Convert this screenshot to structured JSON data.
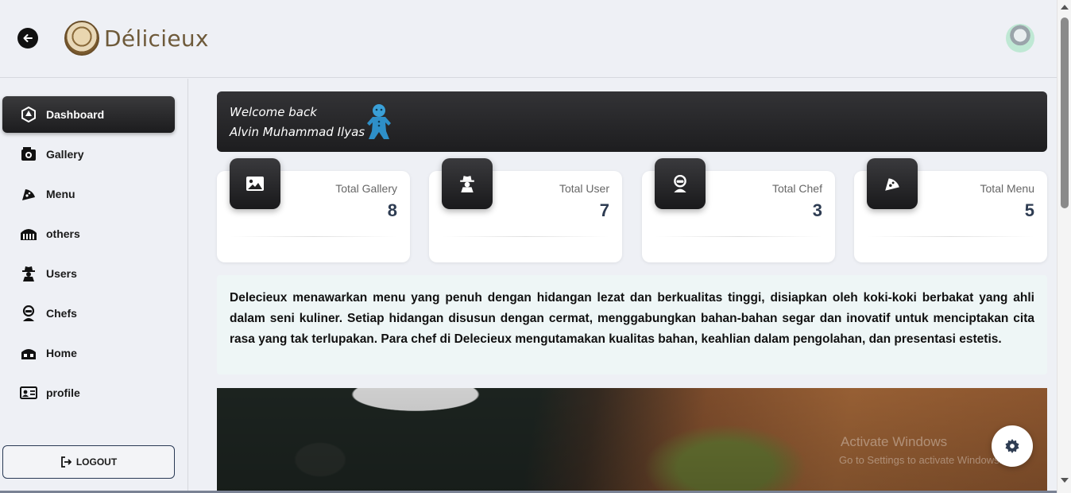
{
  "header": {
    "brand_name": "Délicieux",
    "back_icon": "arrow-left-circle-icon",
    "logo_icon": "burger-logo-icon",
    "avatar_icon": "user-avatar-icon"
  },
  "sidebar": {
    "items": [
      {
        "label": "Dashboard",
        "icon": "dashboard-icon",
        "active": true
      },
      {
        "label": "Gallery",
        "icon": "gallery-icon",
        "active": false
      },
      {
        "label": "Menu",
        "icon": "pizza-icon",
        "active": false
      },
      {
        "label": "others",
        "icon": "store-icon",
        "active": false
      },
      {
        "label": "Users",
        "icon": "user-secret-icon",
        "active": false
      },
      {
        "label": "Chefs",
        "icon": "chef-icon",
        "active": false
      },
      {
        "label": "Home",
        "icon": "home-icon",
        "active": false
      },
      {
        "label": "profile",
        "icon": "id-card-icon",
        "active": false
      }
    ],
    "logout_label": "LOGOUT"
  },
  "welcome": {
    "line1": "Welcome back",
    "line2": "Alvin Muhammad Ilyas"
  },
  "stats": [
    {
      "label": "Total Gallery",
      "value": "8",
      "icon": "image-icon"
    },
    {
      "label": "Total User",
      "value": "7",
      "icon": "user-secret-icon"
    },
    {
      "label": "Total Chef",
      "value": "3",
      "icon": "chef-icon"
    },
    {
      "label": "Total Menu",
      "value": "5",
      "icon": "pizza-icon"
    }
  ],
  "about": {
    "text": "Delecieux menawarkan menu yang penuh dengan hidangan lezat dan berkualitas tinggi, disiapkan oleh koki-koki berbakat yang ahli dalam seni kuliner. Setiap hidangan disusun dengan cermat, menggabungkan bahan-bahan segar dan inovatif untuk menciptakan cita rasa yang tak terlupakan. Para chef di Delecieux mengutamakan kualitas bahan, keahlian dalam pengolahan, dan presentasi estetis."
  },
  "watermark": {
    "line1": "Activate Windows",
    "line2": "Go to Settings to activate Windows."
  },
  "colors": {
    "accent_dark": "#1c1c1e",
    "stat_value": "#2e3c52",
    "brand": "#6e5a3a"
  }
}
